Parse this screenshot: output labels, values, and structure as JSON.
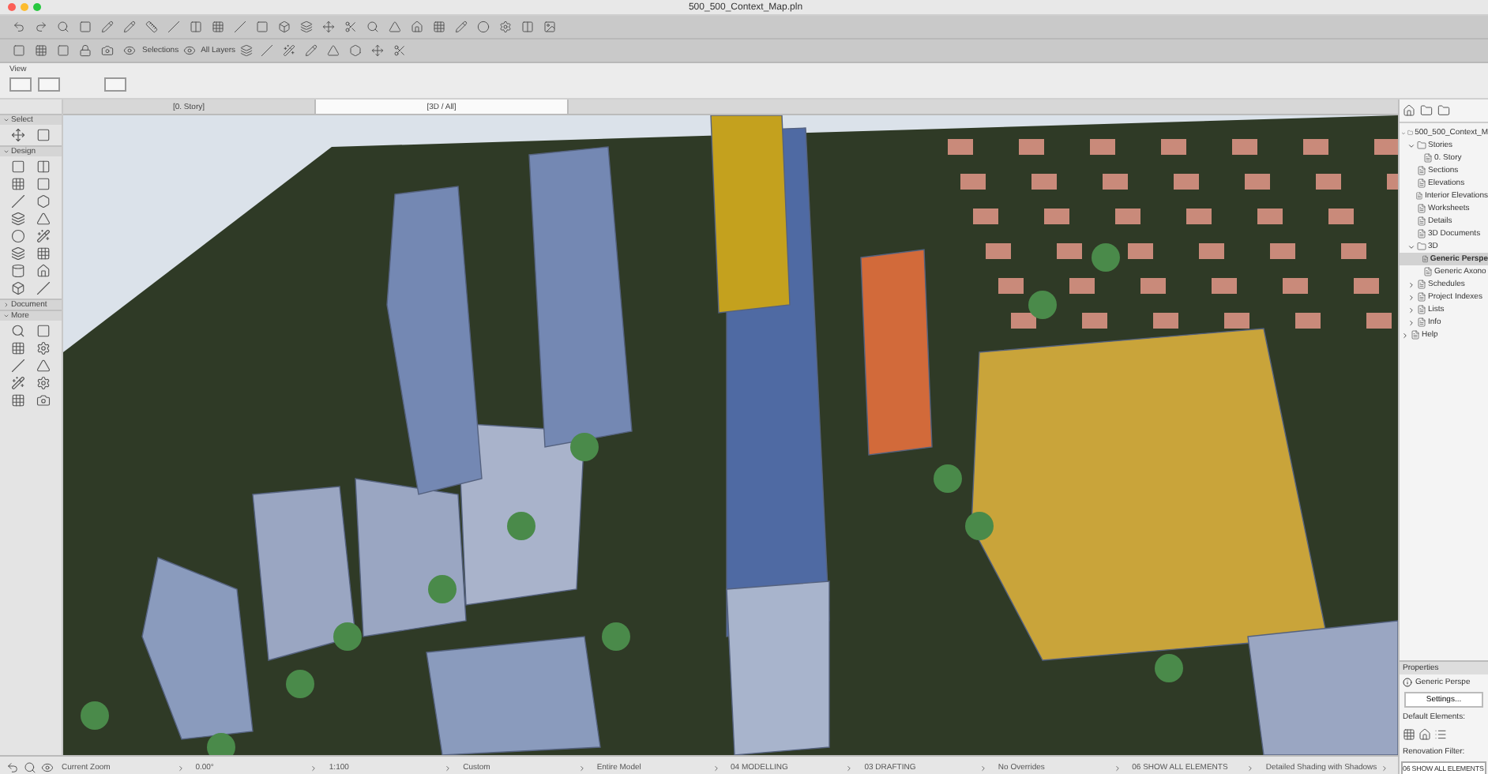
{
  "window": {
    "title": "500_500_Context_Map.pln"
  },
  "toolbar": {
    "selections_label": "Selections",
    "layers_label": "All Layers"
  },
  "view_panel": {
    "label": "View"
  },
  "tabs": [
    {
      "label": "[0. Story]",
      "selected": false
    },
    {
      "label": "[3D / All]",
      "selected": true
    }
  ],
  "toolbox": [
    {
      "title": "Select",
      "expanded": true
    },
    {
      "title": "Design",
      "expanded": true
    },
    {
      "title": "Document",
      "expanded": false
    },
    {
      "title": "More",
      "expanded": true
    }
  ],
  "navigator": {
    "tree": [
      {
        "label": "500_500_Context_M",
        "expanded": true,
        "selected": false,
        "children": [
          {
            "label": "Stories",
            "expanded": true,
            "selected": false,
            "children": [
              {
                "label": "0. Story",
                "selected": false
              }
            ]
          },
          {
            "label": "Sections",
            "selected": false
          },
          {
            "label": "Elevations",
            "selected": false
          },
          {
            "label": "Interior Elevations",
            "selected": false
          },
          {
            "label": "Worksheets",
            "selected": false
          },
          {
            "label": "Details",
            "selected": false
          },
          {
            "label": "3D Documents",
            "selected": false
          },
          {
            "label": "3D",
            "expanded": true,
            "selected": false,
            "children": [
              {
                "label": "Generic Perspe",
                "selected": true
              },
              {
                "label": "Generic Axono",
                "selected": false
              }
            ]
          },
          {
            "label": "Schedules",
            "expanded": false,
            "selected": false
          },
          {
            "label": "Project Indexes",
            "expanded": false,
            "selected": false
          },
          {
            "label": "Lists",
            "expanded": false,
            "selected": false
          },
          {
            "label": "Info",
            "expanded": false,
            "selected": false
          }
        ]
      },
      {
        "label": "Help",
        "expanded": false,
        "selected": false
      }
    ]
  },
  "properties": {
    "title": "Properties",
    "view_name": "Generic Perspe",
    "settings_button": "Settings...",
    "default_elements_label": "Default Elements:",
    "renovation_label": "Renovation Filter:",
    "renovation_value": "06 SHOW ALL ELEMENTS"
  },
  "status_bar": [
    "Current Zoom",
    "0.00°",
    "1:100",
    "Custom",
    "Entire Model",
    "04 MODELLING",
    "03 DRAFTING",
    "No Overrides",
    "06 SHOW ALL ELEMENTS",
    "Detailed Shading with Shadows"
  ]
}
